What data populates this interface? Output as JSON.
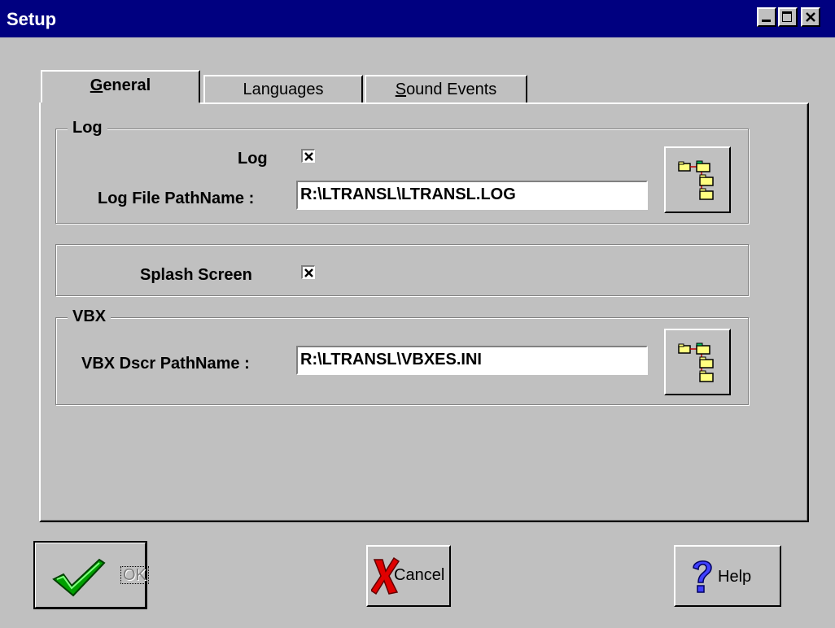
{
  "window": {
    "title": "Setup"
  },
  "tabs": [
    {
      "label": "General",
      "mnemonic": "G",
      "rest": "eneral",
      "active": true
    },
    {
      "label": "Languages",
      "active": false
    },
    {
      "label": "Sound Events",
      "mnemonic": "S",
      "rest": "ound Events",
      "active": false
    }
  ],
  "log_group": {
    "legend": "Log",
    "log_checkbox_label": "Log",
    "log_checked": true,
    "path_label": "Log File PathName :",
    "path_value": "R:\\LTRANSL\\LTRANSL.LOG"
  },
  "splash_group": {
    "label": "Splash Screen",
    "checked": true
  },
  "vbx_group": {
    "legend": "VBX",
    "path_label": "VBX Dscr PathName :",
    "path_value": "R:\\LTRANSL\\VBXES.INI"
  },
  "buttons": {
    "ok": "OK",
    "cancel": "Cancel",
    "help": "Help"
  },
  "icons": {
    "browse": "folder-tree-icon",
    "ok": "checkmark-icon",
    "cancel": "red-x-icon",
    "help": "question-mark-icon"
  }
}
